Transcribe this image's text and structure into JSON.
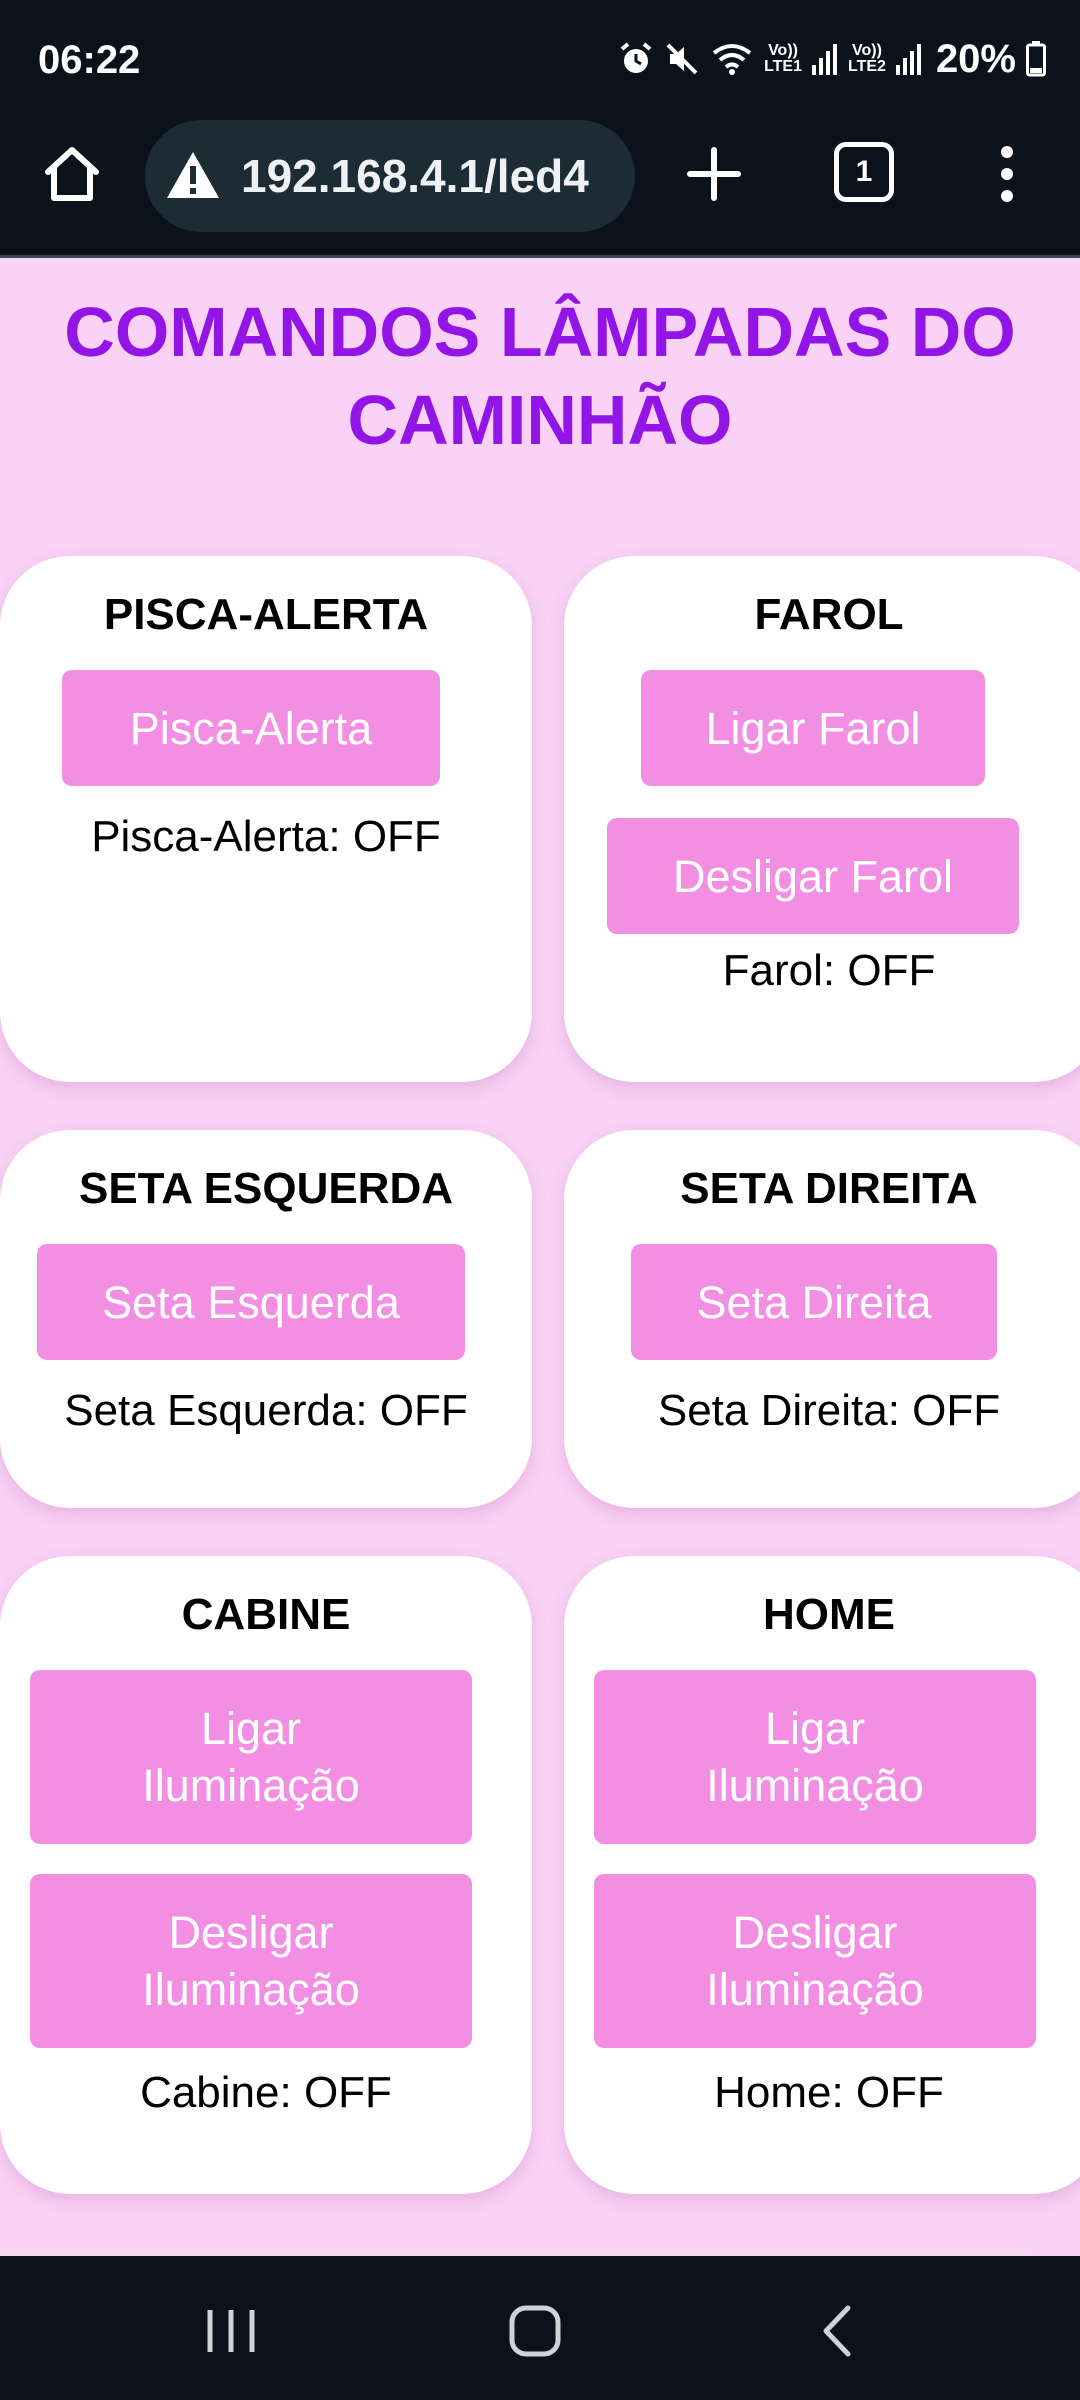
{
  "status_bar": {
    "time": "06:22",
    "icons": [
      "alarm-icon",
      "mute-icon",
      "wifi-icon",
      "signal-icon",
      "battery-icon"
    ],
    "lte1_top": "Vo))",
    "lte1_bottom": "LTE1",
    "lte2_top": "Vo))",
    "lte2_bottom": "LTE2",
    "battery_percent": "20%",
    "battery_level": 0.2
  },
  "browser": {
    "url": "192.168.4.1/led4",
    "tab_count": "1",
    "icons": [
      "home-icon",
      "warning-icon",
      "plus-icon",
      "menu-icon"
    ]
  },
  "page": {
    "title_line1": "COMANDOS LÂMPADAS DO",
    "title_line2": "CAMINHÃO",
    "colors": {
      "title": "#9214e6",
      "background": "#f9d2f5",
      "button": "#f28fe3"
    },
    "cards": {
      "pisca": {
        "title": "PISCA-ALERTA",
        "button": "Pisca-Alerta",
        "state": "Pisca-Alerta: OFF"
      },
      "farol": {
        "title": "FAROL",
        "button_on": "Ligar Farol",
        "button_off": "Desligar Farol",
        "state": "Farol: OFF"
      },
      "seta_esquerda": {
        "title": "SETA ESQUERDA",
        "button": "Seta Esquerda",
        "state": "Seta Esquerda: OFF"
      },
      "seta_direita": {
        "title": "SETA DIREITA",
        "button": "Seta Direita",
        "state": "Seta Direita: OFF"
      },
      "cabine": {
        "title": "CABINE",
        "button_on_1": "Ligar",
        "button_on_2": "Iluminação",
        "button_off_1": "Desligar",
        "button_off_2": "Iluminação",
        "state": "Cabine: OFF"
      },
      "home": {
        "title": "HOME",
        "button_on_1": "Ligar",
        "button_on_2": "Iluminação",
        "button_off_1": "Desligar",
        "button_off_2": "Iluminação",
        "state": "Home: OFF"
      }
    }
  },
  "nav_bar": {
    "icons": [
      "recent-apps-icon",
      "home-nav-icon",
      "back-icon"
    ]
  }
}
